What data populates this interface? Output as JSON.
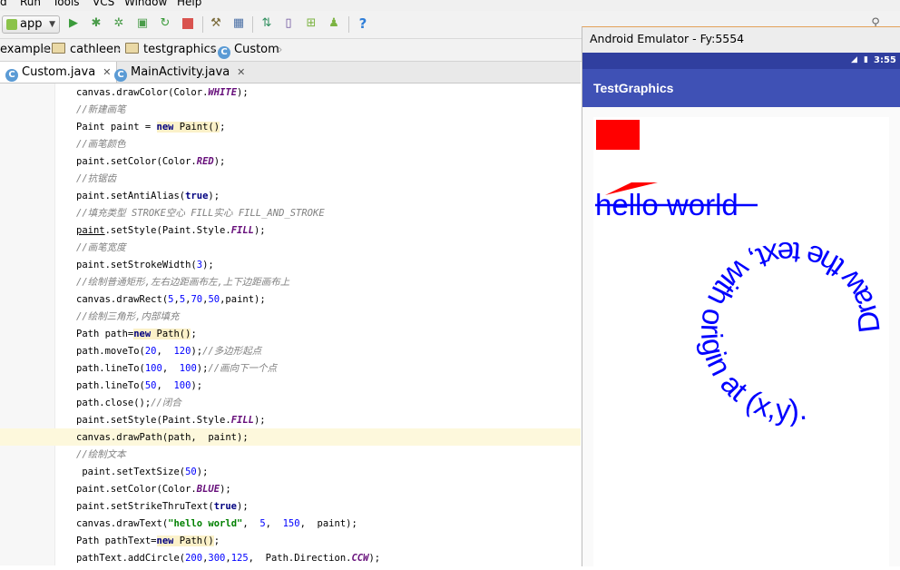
{
  "menubar": {
    "items": [
      "d",
      "Run",
      "Tools",
      "VCS",
      "Window",
      "Help"
    ]
  },
  "toolbar": {
    "config": "app",
    "buttons": [
      "run-icon",
      "debug-icon",
      "attach-debugger-icon",
      "coverage-icon",
      "apply-changes-icon",
      "stop-icon",
      "project-structure-icon",
      "sdk-manager-icon",
      "sync-gradle-icon",
      "avd-manager-icon",
      "android-device-monitor-icon",
      "android-icon",
      "help-icon"
    ],
    "help_label": "?"
  },
  "breadcrumb": [
    "example",
    "cathleen",
    "testgraphics",
    "Custom"
  ],
  "tabs": [
    {
      "label": "Custom.java",
      "active": true
    },
    {
      "label": "MainActivity.java",
      "active": false
    }
  ],
  "code": {
    "l1": [
      "canvas.drawColor(Color.",
      "WHITE",
      ");"
    ],
    "l2": "//新建画笔",
    "l3": [
      "Paint paint = ",
      "new",
      " Paint",
      "()",
      ";"
    ],
    "l4": "//画笔颜色",
    "l5": [
      "paint.setColor(Color.",
      "RED",
      ");"
    ],
    "l6": "//抗锯齿",
    "l7": [
      "paint.setAntiAlias(",
      "true",
      ");"
    ],
    "l8": "//填充类型 STROKE空心 FILL实心 FILL_AND_STROKE",
    "l9": [
      "paint",
      ".setStyle(Paint.Style.",
      "FILL",
      ");"
    ],
    "l10": "//画笔宽度",
    "l11": [
      "paint.setStrokeWidth(",
      "3",
      ");"
    ],
    "l12": "//绘制普通矩形,左右边距画布左,上下边距画布上",
    "l13": [
      "canvas.drawRect(",
      "5",
      ",",
      "5",
      ",",
      "70",
      ",",
      "50",
      ",paint);"
    ],
    "l14": "//绘制三角形,内部填充",
    "l15": [
      "Path path=",
      "new",
      " Path",
      "()",
      ";"
    ],
    "l16": [
      "path.moveTo(",
      "20",
      ",  ",
      "120",
      ");",
      "//多边形起点"
    ],
    "l17": [
      "path.lineTo(",
      "100",
      ",  ",
      "100",
      ");",
      "//画向下一个点"
    ],
    "l18": [
      "path.lineTo(",
      "50",
      ",  ",
      "100",
      ");"
    ],
    "l19": [
      "path.close();",
      "//闭合"
    ],
    "l20": [
      "paint.setStyle(Paint.Style.",
      "FILL",
      ");"
    ],
    "l21": "canvas.drawPath(path,  paint);",
    "l22": "//绘制文本",
    "l23": [
      " paint.setTextSize(",
      "50",
      ");"
    ],
    "l24": [
      "paint.setColor(Color.",
      "BLUE",
      ");"
    ],
    "l25": [
      "paint.setStrikeThruText(",
      "true",
      ");"
    ],
    "l26": [
      "canvas.drawText(",
      "\"hello world\"",
      ",  ",
      "5",
      ",  ",
      "150",
      ",  paint);"
    ],
    "l27": [
      "Path pathText=",
      "new",
      " Path",
      "()",
      ";"
    ],
    "l28": [
      "pathText.addCircle(",
      "200",
      ",",
      "300",
      ",",
      "125",
      ",  Path.Direction.",
      "CCW",
      ");"
    ]
  },
  "emulator": {
    "title": "Android Emulator - Fy:5554",
    "status_time": "3:55",
    "app_title": "TestGraphics",
    "hello_text": "hello world",
    "circle_text": "Draw the text, with origin at (x,y).",
    "colors": {
      "red": "#ff0000",
      "blue": "#0000ff",
      "appbar": "#3f51b5",
      "statusbar": "#303f9f"
    }
  }
}
